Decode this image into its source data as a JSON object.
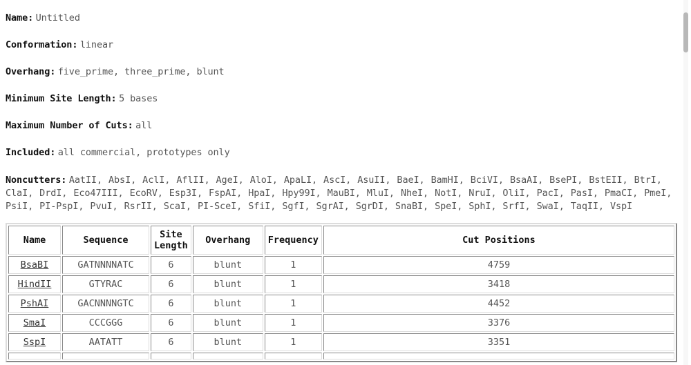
{
  "summary": {
    "items": [
      {
        "label": "Name:",
        "value": "Untitled"
      },
      {
        "label": "Conformation:",
        "value": "linear"
      },
      {
        "label": "Overhang:",
        "value": "five_prime, three_prime, blunt"
      },
      {
        "label": "Minimum Site Length:",
        "value": "5 bases"
      },
      {
        "label": "Maximum Number of Cuts:",
        "value": "all"
      },
      {
        "label": "Included:",
        "value": "all commercial, prototypes only"
      }
    ],
    "noncutters": {
      "label": "Noncutters:",
      "value": "AatII, AbsI, AclI, AflII, AgeI, AloI, ApaLI, AscI, AsuII, BaeI, BamHI, BciVI, BsaAI, BsePI, BstEII, BtrI, ClaI, DrdI, Eco47III, EcoRV, Esp3I, FspAI, HpaI, Hpy99I, MauBI, MluI, NheI, NotI, NruI, OliI, PacI, PasI, PmaCI, PmeI, PsiI, PI-PspI, PvuI, RsrII, ScaI, PI-SceI, SfiI, SgfI, SgrAI, SgrDI, SnaBI, SpeI, SphI, SrfI, SwaI, TaqII, VspI"
    }
  },
  "table": {
    "headers": {
      "name": "Name",
      "sequence": "Sequence",
      "site_length_line1": "Site",
      "site_length_line2": "Length",
      "overhang": "Overhang",
      "frequency": "Frequency",
      "cut_positions": "Cut Positions"
    },
    "rows": [
      {
        "name": "BsaBI",
        "sequence": "GATNNNNATC",
        "site_length": "6",
        "overhang": "blunt",
        "frequency": "1",
        "cut_positions": "4759"
      },
      {
        "name": "HindII",
        "sequence": "GTYRAC",
        "site_length": "6",
        "overhang": "blunt",
        "frequency": "1",
        "cut_positions": "3418"
      },
      {
        "name": "PshAI",
        "sequence": "GACNNNNGTC",
        "site_length": "6",
        "overhang": "blunt",
        "frequency": "1",
        "cut_positions": "4452"
      },
      {
        "name": "SmaI",
        "sequence": "CCCGGG",
        "site_length": "6",
        "overhang": "blunt",
        "frequency": "1",
        "cut_positions": "3376"
      },
      {
        "name": "SspI",
        "sequence": "AATATT",
        "site_length": "6",
        "overhang": "blunt",
        "frequency": "1",
        "cut_positions": "3351"
      },
      {
        "name": "",
        "sequence": "",
        "site_length": "",
        "overhang": "",
        "frequency": "",
        "cut_positions": ""
      }
    ]
  },
  "colors": {
    "label_text": "#111111",
    "value_text": "#555555",
    "background": "#ffffff",
    "border": "#dcdcdc",
    "scrollbar_thumb": "#b8b8b8"
  }
}
